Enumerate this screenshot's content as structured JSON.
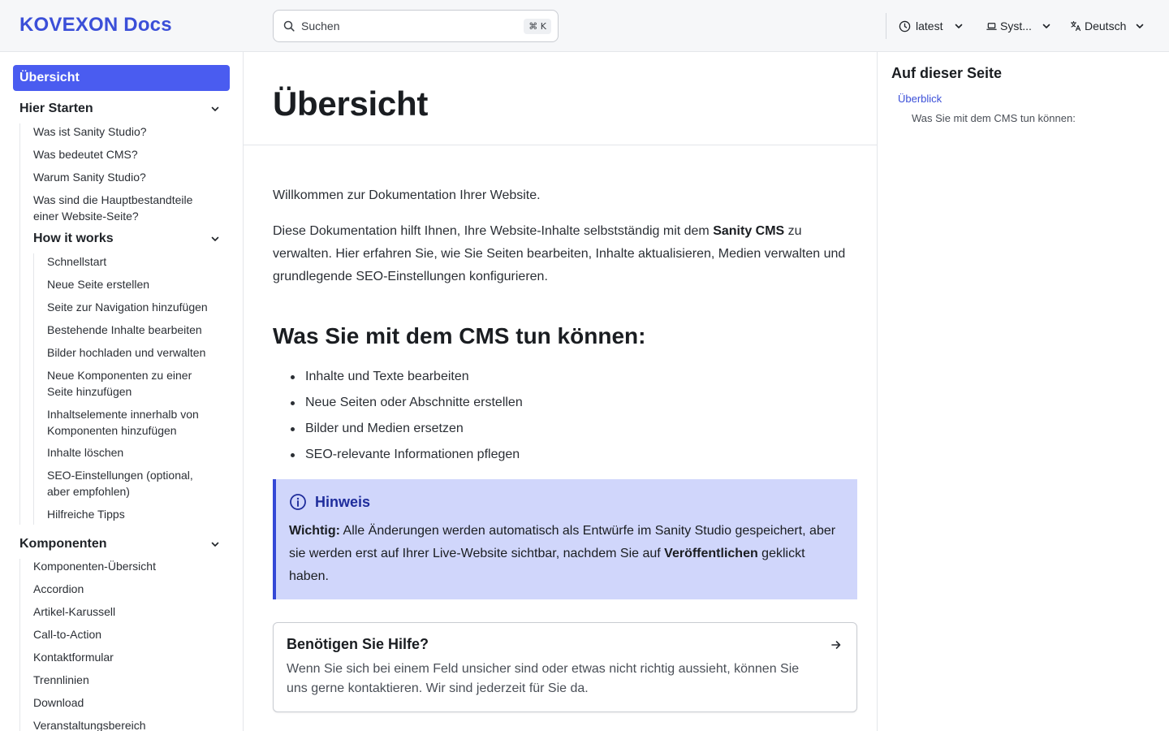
{
  "header": {
    "logo": "KOVEXON Docs",
    "search_placeholder": "Suchen",
    "search_shortcut": "⌘ K",
    "version": "latest",
    "theme": "Syst...",
    "language": "Deutsch"
  },
  "sidebar": {
    "active": "Übersicht",
    "hier_starten": {
      "label": "Hier Starten",
      "items": [
        "Was ist Sanity Studio?",
        "Was bedeutet CMS?",
        "Warum Sanity Studio?",
        "Was sind die Hauptbestandteile einer Website-Seite?"
      ],
      "how_it_works": {
        "label": "How it works",
        "items": [
          "Schnellstart",
          "Neue Seite erstellen",
          "Seite zur Navigation hinzufügen",
          "Bestehende Inhalte bearbeiten",
          "Bilder hochladen und verwalten",
          "Neue Komponenten zu einer Seite hinzufügen",
          "Inhaltselemente innerhalb von Komponenten hinzufügen",
          "Inhalte löschen",
          "SEO-Einstellungen (optional, aber empfohlen)",
          "Hilfreiche Tipps"
        ]
      }
    },
    "komponenten": {
      "label": "Komponenten",
      "items": [
        "Komponenten-Übersicht",
        "Accordion",
        "Artikel-Karussell",
        "Call-to-Action",
        "Kontaktformular",
        "Trennlinien",
        "Download",
        "Veranstaltungsbereich"
      ]
    }
  },
  "main": {
    "title": "Übersicht",
    "intro": "Willkommen zur Dokumentation Ihrer Website.",
    "para_prefix": "Diese Dokumentation hilft Ihnen, Ihre Website-Inhalte selbstständig mit dem ",
    "para_bold": "Sanity CMS",
    "para_suffix": " zu verwalten. Hier erfahren Sie, wie Sie Seiten bearbeiten, Inhalte aktualisieren, Medien verwalten und grundlegende SEO-Einstellungen konfigurieren.",
    "h2": "Was Sie mit dem CMS tun können:",
    "bullets": [
      "Inhalte und Texte bearbeiten",
      "Neue Seiten oder Abschnitte erstellen",
      "Bilder und Medien ersetzen",
      "SEO-relevante Informationen pflegen"
    ],
    "note": {
      "title": "Hinweis",
      "bold_lead": "Wichtig:",
      "text1": " Alle Änderungen werden automatisch als Entwürfe im Sanity Studio gespeichert, aber sie werden erst auf Ihrer Live-Website sichtbar, nachdem Sie auf ",
      "bold_action": "Veröffentlichen",
      "text2": " geklickt haben."
    },
    "help": {
      "title": "Benötigen Sie Hilfe?",
      "text": "Wenn Sie sich bei einem Feld unsicher sind oder etwas nicht richtig aussieht, können Sie uns gerne kontaktieren. Wir sind jederzeit für Sie da."
    }
  },
  "toc": {
    "title": "Auf dieser Seite",
    "link": "Überblick",
    "sub": "Was Sie mit dem CMS tun können:"
  },
  "colors": {
    "accent": "#3b4fd8",
    "active_nav": "#4a5cf0",
    "note_bg": "#d0d6fb",
    "note_border": "#3448d6"
  },
  "icons": {
    "search": "search-icon",
    "version": "clock-icon",
    "theme": "laptop-icon",
    "language": "translate-icon",
    "chevron": "chevron-down-icon",
    "info": "info-icon",
    "arrow": "arrow-right-icon"
  }
}
